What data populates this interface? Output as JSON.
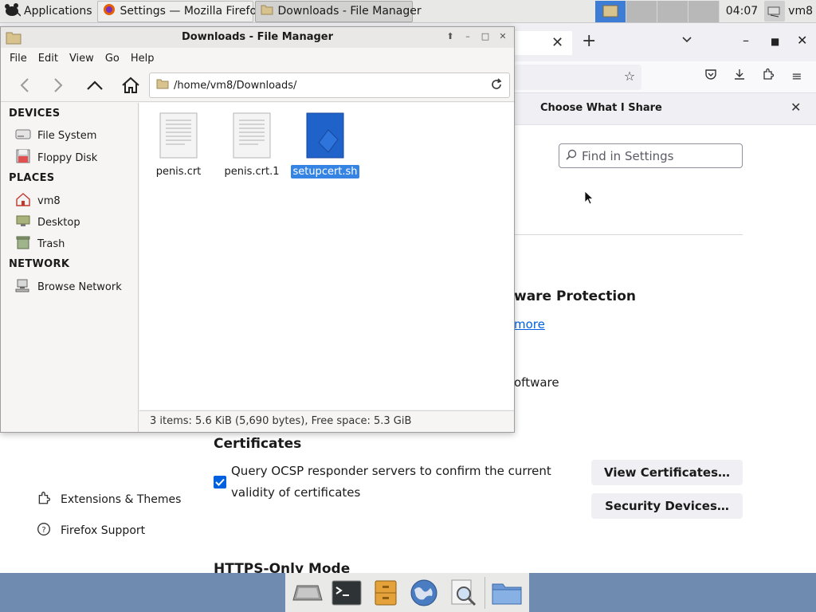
{
  "top_panel": {
    "applications_label": "Applications",
    "tasks": [
      {
        "label": "Settings — Mozilla Firefox"
      },
      {
        "label": "Downloads - File Manager"
      }
    ],
    "clock": "04:07",
    "user": "vm8"
  },
  "firefox": {
    "notice_button": "Choose What I Share",
    "search_placeholder": "Find in Settings",
    "malware_heading": "ware Protection",
    "learn_more": "more",
    "malware_text": "oftware",
    "cert_heading": "Certificates",
    "ocsp_label": "Query OCSP responder servers to confirm the current validity of certificates",
    "view_certs_button": "View Certificates…",
    "security_devices_button": "Security Devices…",
    "extensions_themes": "Extensions & Themes",
    "firefox_support": "Firefox Support",
    "https_heading": "HTTPS-Only Mode"
  },
  "file_manager": {
    "title": "Downloads - File Manager",
    "menu": [
      "File",
      "Edit",
      "View",
      "Go",
      "Help"
    ],
    "path": "/home/vm8/Downloads/",
    "sidebar": {
      "devices_heading": "DEVICES",
      "devices": [
        "File System",
        "Floppy Disk"
      ],
      "places_heading": "PLACES",
      "places": [
        "vm8",
        "Desktop",
        "Trash"
      ],
      "network_heading": "NETWORK",
      "network": [
        "Browse Network"
      ]
    },
    "files": [
      {
        "name": "penis.crt",
        "icon": "text-file-icon"
      },
      {
        "name": "penis.crt.1",
        "icon": "text-file-icon"
      },
      {
        "name": "setupcert.sh",
        "icon": "script-file-icon",
        "selected": true
      }
    ],
    "status": "3 items: 5.6 KiB (5,690 bytes), Free space: 5.3 GiB"
  },
  "dock": {
    "items": [
      "desktop-icon",
      "terminal-icon",
      "file-cabinet-icon",
      "web-browser-icon",
      "search-magnifier-icon",
      "folder-icon"
    ]
  },
  "colors": {
    "selection": "#3584e4",
    "firefox_accent": "#0061e0",
    "dock_bg": "#6f8bb0",
    "workspace_current": "#3d7dd6"
  }
}
